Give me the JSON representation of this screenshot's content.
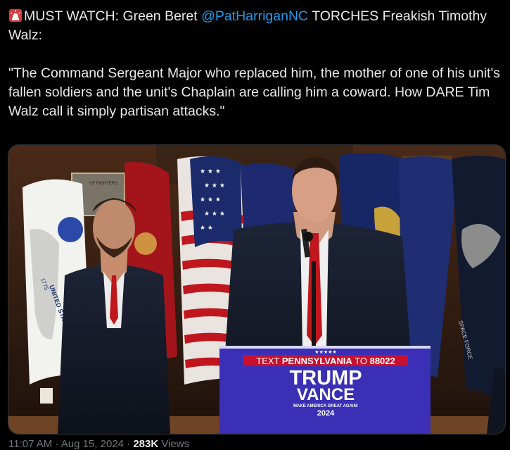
{
  "tweet": {
    "prefix": "MUST WATCH: Green Beret ",
    "mention": "@PatHarriganNC",
    "after_mention": " TORCHES Freakish Timothy Walz:",
    "quote": "\"The Command Sergeant Major who replaced him, the mother of one of his unit's fallen soldiers and the unit's Chaplain are calling him a coward. How DARE Tim Walz call it simply partisan attacks.\""
  },
  "media": {
    "podium_text_top": "TEXT PENNSYLVANIA TO 88022",
    "podium_text_prefix": "TEXT ",
    "podium_text_state": "PENNSYLVANIA",
    "podium_text_to": " TO ",
    "podium_text_number": "88022",
    "podium_stars": "★★★★★",
    "podium_trump": "TRUMP",
    "podium_vance": "VANCE",
    "podium_slogan": "MAKE AMERICA GREAT AGAIN!",
    "podium_year": "2024",
    "plaque_text": "OF FIGHTERS",
    "army_flag_text": "UNITED STATES ARMY",
    "army_flag_year": "1775",
    "space_force_text": "SPACE FORCE",
    "colors": {
      "podium": "#3b2fb5",
      "podium_red": "#c8102e",
      "tie": "#c0161e"
    }
  },
  "footer": {
    "time": "11:07 AM · Aug 15, 2024 · ",
    "views_count": "283K",
    "views_label": " Views"
  },
  "icons": {
    "siren": "siren-icon"
  }
}
